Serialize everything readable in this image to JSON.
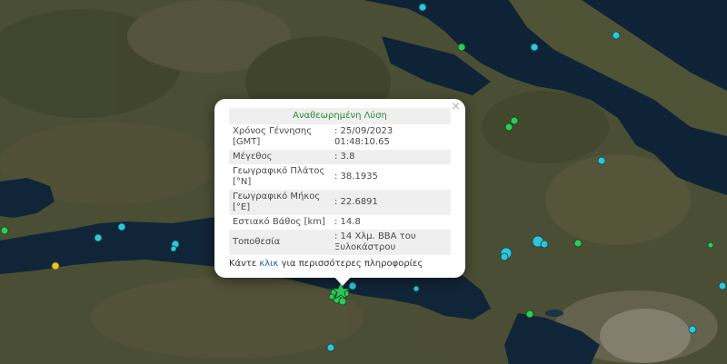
{
  "popup": {
    "header": "Αναθεωρημένη Λύση",
    "close_label": "×",
    "rows": [
      {
        "label": "Χρόνος Γέννησης [GMT]",
        "value": ": 25/09/2023 01:48:10.65"
      },
      {
        "label": "Μέγεθος",
        "value": ": 3.8"
      },
      {
        "label": "Γεωγραφικό Πλάτος [°N]",
        "value": ": 38.1935"
      },
      {
        "label": "Γεωγραφικό Μήκος [°E]",
        "value": ": 22.6891"
      },
      {
        "label": "Εστιακό Βάθος [km]",
        "value": ": 14.8"
      },
      {
        "label": "Τοποθεσία",
        "value": ": 14 Χλμ. ΒΒΑ του Ξυλοκάστρου"
      }
    ],
    "more_prefix": "Κάντε ",
    "more_link": "κλικ",
    "more_suffix": " για περισσότερες πληροφορίες"
  },
  "map": {
    "marker_colors": {
      "recent": "#2ec95a",
      "older": "#31c6d6",
      "oldest": "#e8c52a"
    }
  }
}
